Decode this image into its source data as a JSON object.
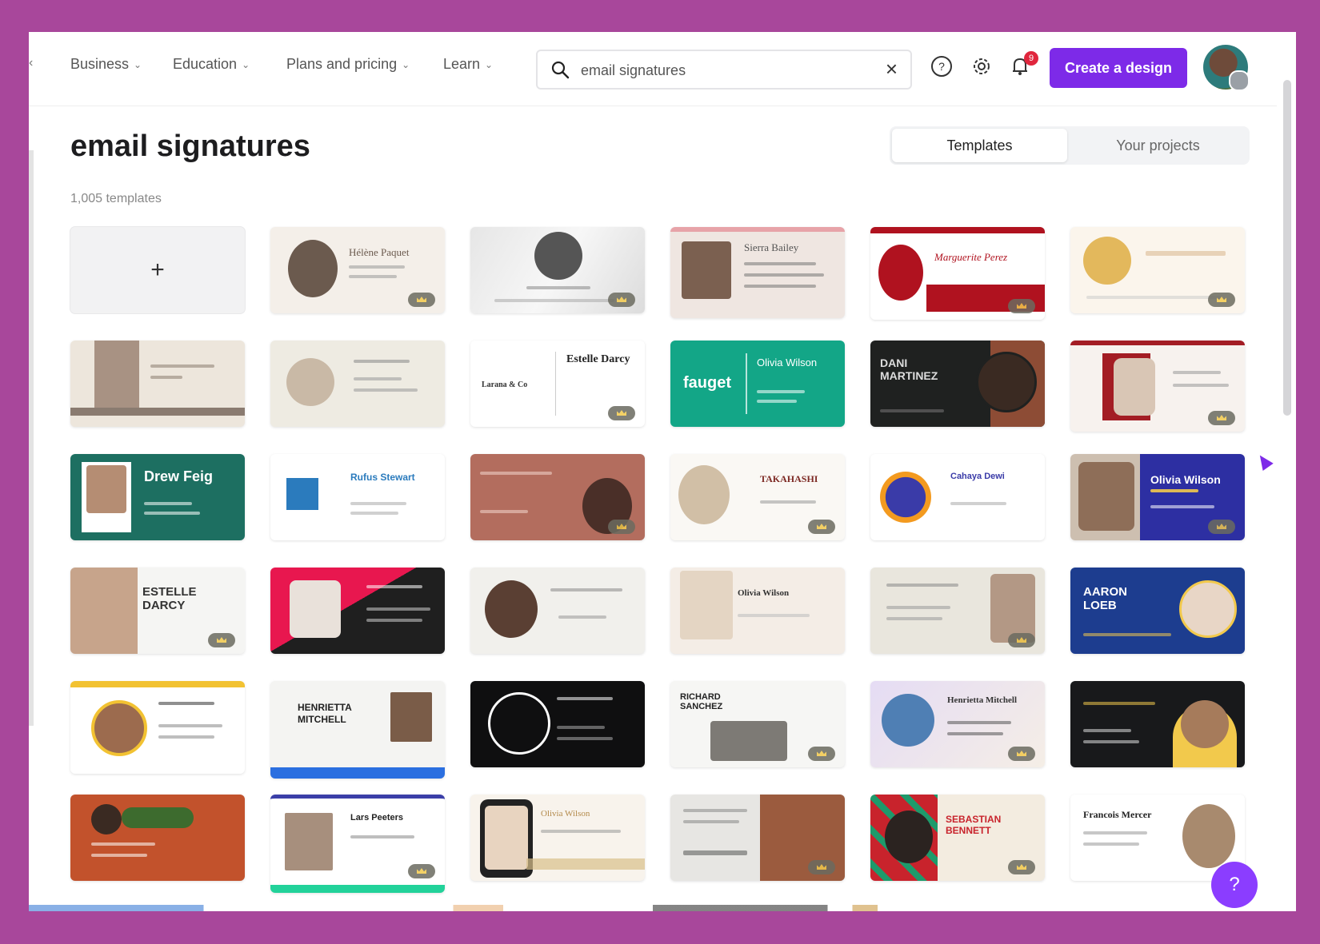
{
  "nav": {
    "items": [
      {
        "label": "Business"
      },
      {
        "label": "Education"
      },
      {
        "label": "Plans and pricing"
      },
      {
        "label": "Learn"
      }
    ],
    "search": {
      "value": "email signatures"
    },
    "notification_count": "9",
    "create_label": "Create a design"
  },
  "page": {
    "title": "email signatures",
    "count": "1,005 templates",
    "tabs": {
      "templates": "Templates",
      "projects": "Your projects"
    }
  },
  "cards": {
    "c1": "Hélène Paquet",
    "c3": "Sierra Bailey",
    "c4": "Marguerite Perez",
    "c9": "Estelle Darcy",
    "c9b": "Larana & Co",
    "c10": "fauget",
    "c10b": "Olivia Wilson",
    "c11": "DANI MARTINEZ",
    "c13": "Drew Feig",
    "c14": "Rufus Stewart",
    "c16": "TAKAHASHI",
    "c17": "Cahaya Dewi",
    "c18": "Olivia Wilson",
    "c19": "ESTELLE DARCY",
    "c22": "Olivia Wilson",
    "c24": "AARON LOEB",
    "c26": "HENRIETTA MITCHELL",
    "c28": "RICHARD SANCHEZ",
    "c29": "Henrietta Mitchell",
    "c33": "Lars Peeters",
    "c34": "Olivia Wilson",
    "c36": "SEBASTIAN BENNETT",
    "c37": "Francois Mercer"
  },
  "help_label": "?",
  "colors": {
    "accent": "#7d2ae8",
    "frame": "#a8479b"
  }
}
